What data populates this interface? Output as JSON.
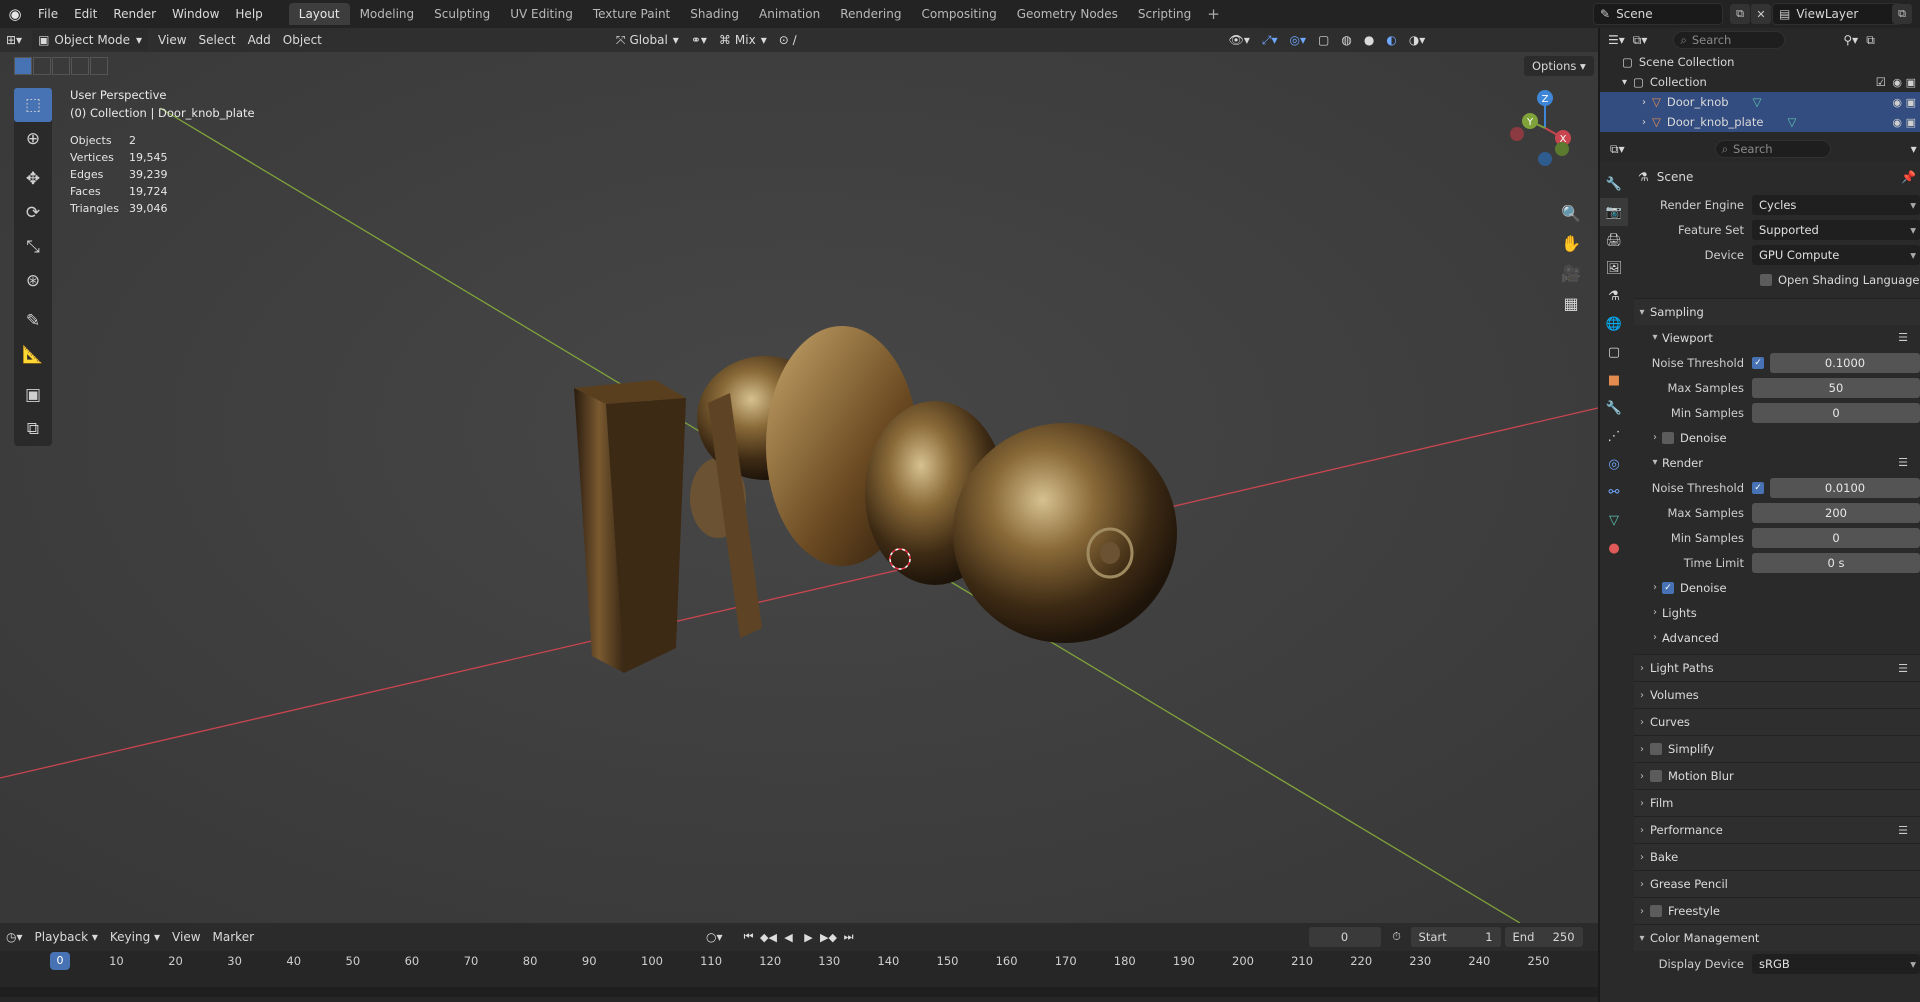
{
  "topbar": {
    "menus": [
      "File",
      "Edit",
      "Render",
      "Window",
      "Help"
    ],
    "workspaces": [
      "Layout",
      "Modeling",
      "Sculpting",
      "UV Editing",
      "Texture Paint",
      "Shading",
      "Animation",
      "Rendering",
      "Compositing",
      "Geometry Nodes",
      "Scripting"
    ],
    "active_workspace": "Layout",
    "scene": "Scene",
    "view_layer": "ViewLayer"
  },
  "viewport": {
    "mode": "Object Mode",
    "menus": [
      "View",
      "Select",
      "Add",
      "Object"
    ],
    "transform_orientation": "Global",
    "snap_mode": "Mix",
    "options": "Options",
    "view_name": "User Perspective",
    "collection_line": "(0) Collection | Door_knob_plate",
    "stats": [
      {
        "label": "Objects",
        "value": "2"
      },
      {
        "label": "Vertices",
        "value": "19,545"
      },
      {
        "label": "Edges",
        "value": "39,239"
      },
      {
        "label": "Faces",
        "value": "19,724"
      },
      {
        "label": "Triangles",
        "value": "39,046"
      }
    ],
    "gizmo": {
      "x": "X",
      "y": "Y",
      "z": "Z"
    }
  },
  "timeline": {
    "menus": [
      "Playback",
      "Keying",
      "View",
      "Marker"
    ],
    "current_frame": "0",
    "start_label": "Start",
    "start": "1",
    "end_label": "End",
    "end": "250",
    "ruler": [
      "0",
      "10",
      "20",
      "30",
      "40",
      "50",
      "60",
      "70",
      "80",
      "90",
      "100",
      "110",
      "120",
      "130",
      "140",
      "150",
      "160",
      "170",
      "180",
      "190",
      "200",
      "210",
      "220",
      "230",
      "240",
      "250"
    ]
  },
  "outliner": {
    "search_placeholder": "Search",
    "scene_collection": "Scene Collection",
    "collection": "Collection",
    "objects": [
      "Door_knob",
      "Door_knob_plate"
    ]
  },
  "properties": {
    "search_placeholder": "Search",
    "title": "Scene",
    "render_engine_label": "Render Engine",
    "render_engine": "Cycles",
    "feature_set_label": "Feature Set",
    "feature_set": "Supported",
    "device_label": "Device",
    "device": "GPU Compute",
    "osl_label": "Open Shading Language",
    "sampling": "Sampling",
    "viewport_label": "Viewport",
    "noise_threshold_label": "Noise Threshold",
    "vp_noise_threshold": "0.1000",
    "max_samples_label": "Max Samples",
    "vp_max_samples": "50",
    "min_samples_label": "Min Samples",
    "vp_min_samples": "0",
    "denoise_label": "Denoise",
    "render_label": "Render",
    "r_noise_threshold": "0.0100",
    "r_max_samples": "200",
    "r_min_samples": "0",
    "time_limit_label": "Time Limit",
    "time_limit": "0 s",
    "lights_label": "Lights",
    "advanced_label": "Advanced",
    "panels": [
      "Light Paths",
      "Volumes",
      "Curves",
      "Simplify",
      "Motion Blur",
      "Film",
      "Performance",
      "Bake",
      "Grease Pencil",
      "Freestyle",
      "Color Management"
    ],
    "display_device_label": "Display Device",
    "display_device": "sRGB"
  },
  "colors": {
    "accent": "#4772b3",
    "x_axis": "#c8454f",
    "y_axis": "#7fa33a",
    "z_axis": "#3f86d6"
  }
}
